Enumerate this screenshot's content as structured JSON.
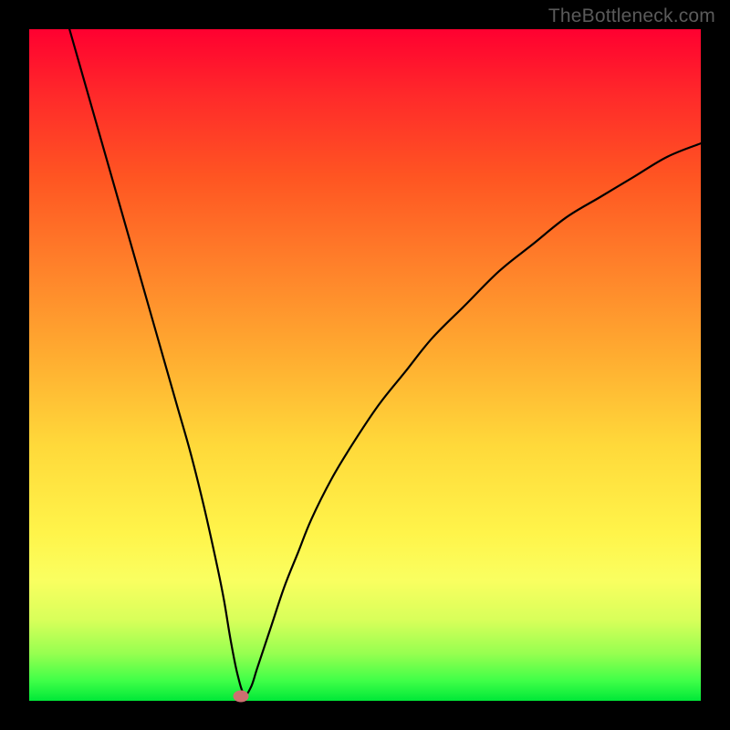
{
  "watermark": "TheBottleneck.com",
  "colors": {
    "frame": "#000000",
    "gradient_top": "#ff0030",
    "gradient_bottom": "#00e838",
    "curve": "#000000",
    "marker": "#cc7070"
  },
  "chart_data": {
    "type": "line",
    "title": "",
    "xlabel": "",
    "ylabel": "",
    "xlim": [
      0,
      100
    ],
    "ylim": [
      0,
      100
    ],
    "grid": false,
    "legend": false,
    "annotations": [],
    "series": [
      {
        "name": "bottleneck-curve",
        "x": [
          6,
          8,
          10,
          12,
          14,
          16,
          18,
          20,
          22,
          24,
          26,
          28,
          29,
          30,
          31,
          32,
          33,
          34,
          36,
          38,
          40,
          42,
          45,
          48,
          52,
          56,
          60,
          65,
          70,
          75,
          80,
          85,
          90,
          95,
          100
        ],
        "y": [
          100,
          93,
          86,
          79,
          72,
          65,
          58,
          51,
          44,
          37,
          29,
          20,
          15,
          9,
          4,
          1,
          2,
          5,
          11,
          17,
          22,
          27,
          33,
          38,
          44,
          49,
          54,
          59,
          64,
          68,
          72,
          75,
          78,
          81,
          83
        ]
      }
    ],
    "marker": {
      "x": 31.5,
      "y": 0.7
    }
  }
}
